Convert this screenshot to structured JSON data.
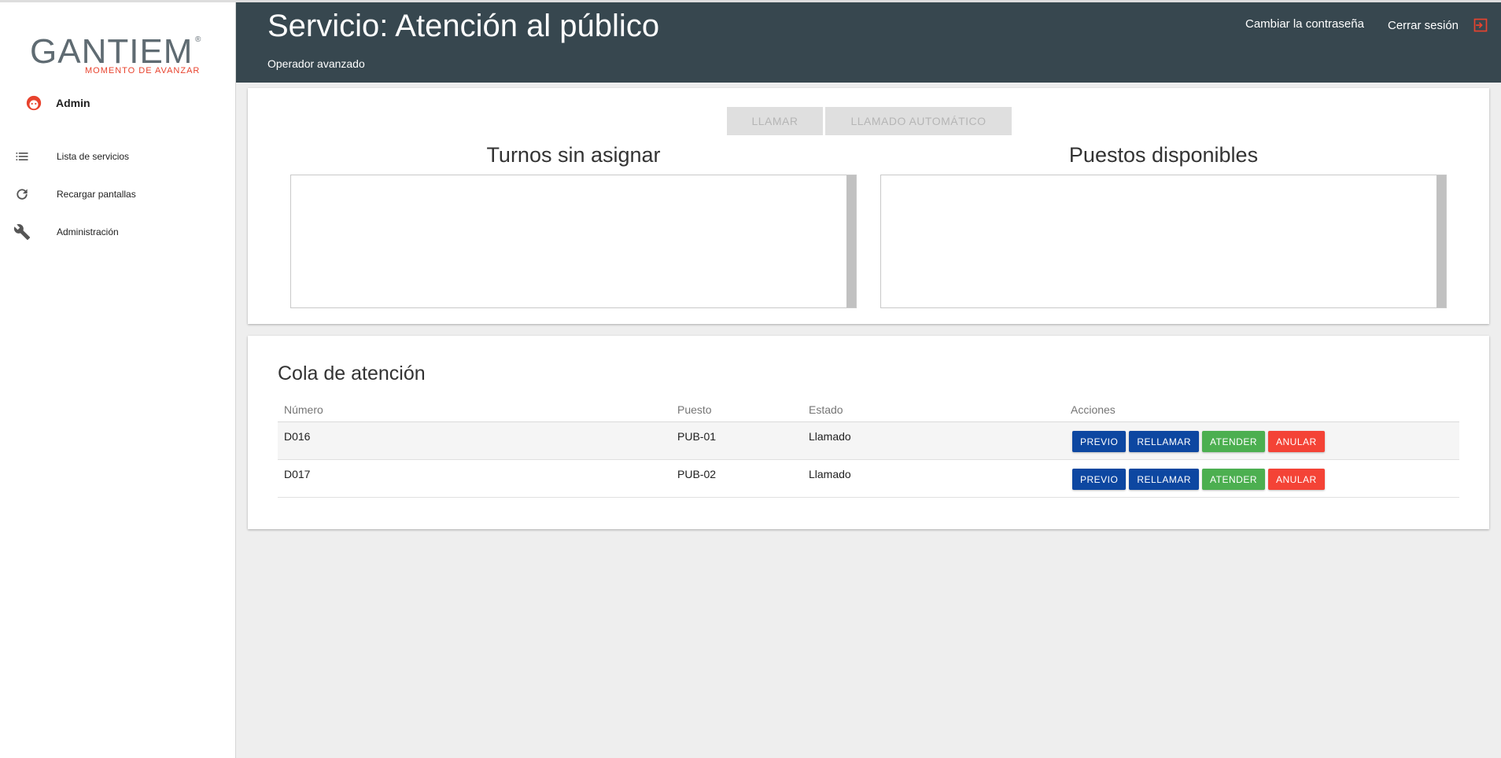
{
  "brand": {
    "name": "GANTIEM",
    "registered": "®",
    "tagline": "MOMENTO DE AVANZAR"
  },
  "user": {
    "name": "Admin"
  },
  "sidebar": {
    "items": [
      {
        "label": "Lista de servicios",
        "icon": "list-icon"
      },
      {
        "label": "Recargar pantallas",
        "icon": "refresh-icon"
      },
      {
        "label": "Administración",
        "icon": "wrench-icon"
      }
    ]
  },
  "header": {
    "title": "Servicio: Atención al público",
    "subtitle": "Operador avanzado",
    "change_password": "Cambiar la contraseña",
    "logout": "Cerrar sesión"
  },
  "controls": {
    "call_label": "LLAMAR",
    "auto_call_label": "LLAMADO AUTOMÁTICO"
  },
  "panels": {
    "unassigned_title": "Turnos sin asignar",
    "available_title": "Puestos disponibles"
  },
  "queue": {
    "title": "Cola de atención",
    "columns": [
      "Número",
      "Puesto",
      "Estado",
      "Acciones"
    ],
    "rows": [
      {
        "numero": "D016",
        "puesto": "PUB-01",
        "estado": "Llamado"
      },
      {
        "numero": "D017",
        "puesto": "PUB-02",
        "estado": "Llamado"
      }
    ],
    "actions": {
      "previo": "PREVIO",
      "rellamar": "RELLAMAR",
      "atender": "ATENDER",
      "anular": "ANULAR"
    }
  },
  "colors": {
    "header_bg": "#37474f",
    "brand_red": "#e8432e",
    "btn_blue": "#0d47a1",
    "btn_green": "#4caf50",
    "btn_red": "#f44336"
  }
}
